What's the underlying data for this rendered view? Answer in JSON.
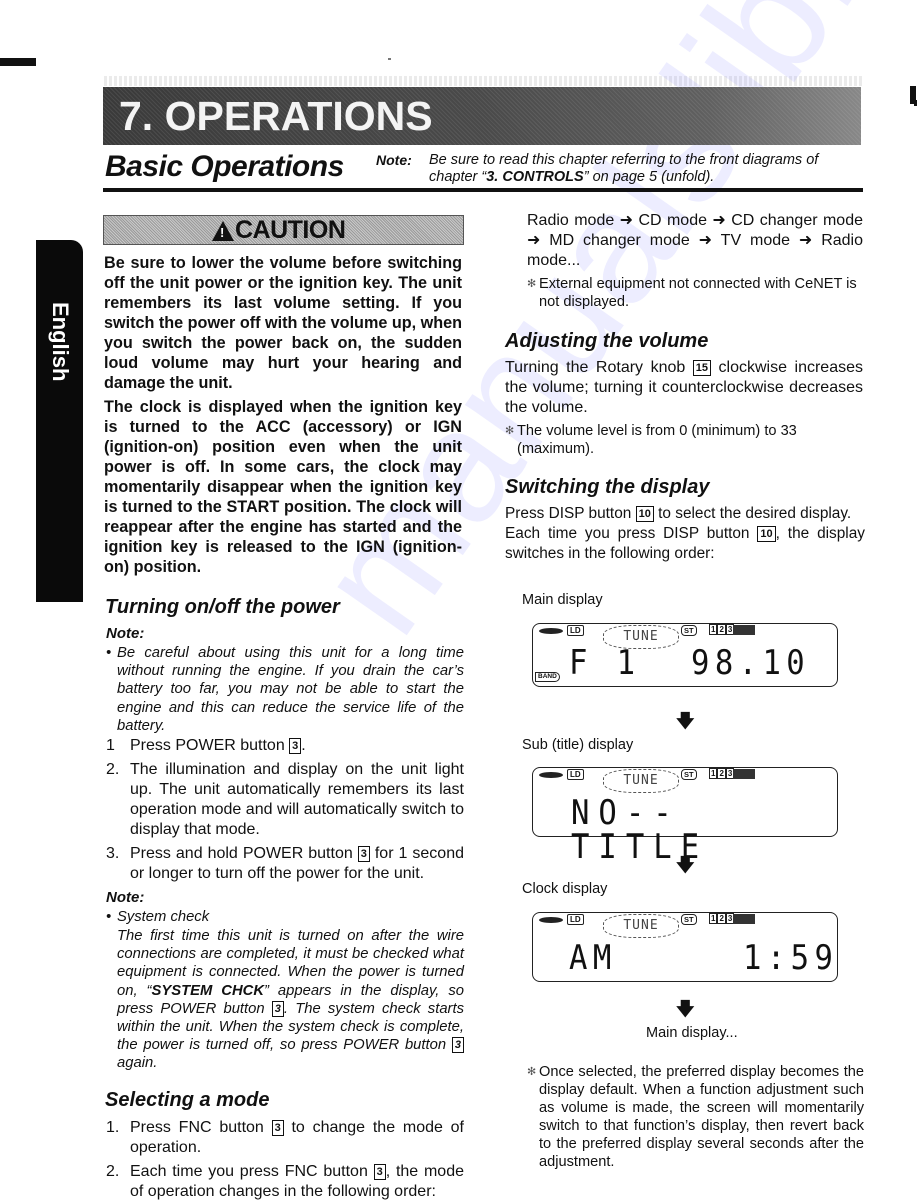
{
  "chapter": {
    "title": "7. OPERATIONS"
  },
  "section": {
    "title": "Basic Operations",
    "note_label": "Note:",
    "note_text_pre": "Be sure to read this chapter referring to the front diagrams of chapter “",
    "note_text_bold": "3. CONTROLS",
    "note_text_post": "” on page 5 (unfold)."
  },
  "side_tab": {
    "label": "English"
  },
  "caution": {
    "label": "CAUTION",
    "icon": "warning-triangle-icon",
    "paragraph1": "Be sure to lower the volume before switching off the unit power or the ignition key. The unit remembers its last volume setting. If you switch the power off with the volume up, when you switch the power back on, the sudden loud volume may hurt your hearing and damage the unit.",
    "paragraph2": "The clock is displayed when the ignition key is turned to the ACC (accessory) or IGN (ignition-on) position even when the unit power is off. In some cars, the clock may momentarily disappear when the ignition key is turned to the START position. The clock will reappear after the engine has started and the ignition key is released to the IGN (ignition-on) position."
  },
  "power": {
    "title": "Turning on/off the power",
    "note_label": "Note:",
    "note_bullet": "Be careful about using this unit for a long time without running the engine. If you drain the car’s battery too far, you may not be able to start the engine and this can reduce the service life of the battery.",
    "steps": [
      {
        "num": "1",
        "pre": "Press POWER button ",
        "box": "3",
        "post": "."
      },
      {
        "num": "2.",
        "pre": "The illumination and display on the unit light up. The unit automatically remembers its last operation mode and will automatically switch to display that mode.",
        "box": "",
        "post": ""
      },
      {
        "num": "3.",
        "pre": "Press and hold POWER button ",
        "box": "3",
        "post": " for 1 second or longer to turn off the power for the unit."
      }
    ],
    "note2_label": "Note:",
    "note2_bullet_title": "System check",
    "note2_pre": "The first time this unit is turned on after the wire connections are completed, it must be checked what equipment is connected. When the power is turned on, “",
    "note2_bold": "SYSTEM CHCK",
    "note2_mid": "” appears in the display, so press POWER button ",
    "note2_box1": "3",
    "note2_mid2": ". The system check starts within the unit. When the system check is complete, the power is turned off, so press POWER button ",
    "note2_box2": "3",
    "note2_post": " again."
  },
  "mode": {
    "title": "Selecting a mode",
    "steps": [
      {
        "num": "1.",
        "pre": "Press FNC button ",
        "box": "3",
        "post": " to change the mode of operation."
      },
      {
        "num": "2.",
        "pre": "Each time you press FNC button ",
        "box": "3",
        "post": ", the mode of operation changes in the following order:"
      }
    ],
    "order_text": "Radio mode ➜ CD mode ➜ CD changer mode ➜ MD changer mode ➜ TV mode ➜ Radio mode...",
    "footnote": "External equipment not connected with CeNET is not displayed."
  },
  "volume": {
    "title": "Adjusting the volume",
    "text_pre": "Turning the Rotary knob ",
    "box": "15",
    "text_post": " clockwise increases the volume; turning it counterclockwise decreases the volume.",
    "footnote": "The volume level is from 0 (minimum) to 33 (maximum)."
  },
  "display": {
    "title": "Switching the display",
    "text1_pre": "Press DISP button ",
    "box": "10",
    "text1_post": " to select the desired display.",
    "text2_pre": "Each time you press DISP button ",
    "text2_post": ", the display switches in the following order:",
    "screens": [
      {
        "caption": "Main display",
        "left_text": "F 1",
        "right_text": "98.10"
      },
      {
        "caption": "Sub (title) display",
        "left_text": "NO--TITLE",
        "right_text": ""
      },
      {
        "caption": "Clock display",
        "left_text": "AM",
        "right_text": "1:59"
      }
    ],
    "lcd_indicators": {
      "loud": "LD",
      "tune": "TUNE",
      "stereo": "ST",
      "presets": [
        "1",
        "2",
        "3"
      ],
      "band": "BAND"
    },
    "end_caption": "Main display...",
    "footnote": "Once selected, the preferred display becomes the display default. When a function adjustment such as volume is made, the screen will momentarily switch to that function’s display, then revert back to the preferred display several seconds after the adjustment."
  },
  "watermark": "manualslib.com"
}
